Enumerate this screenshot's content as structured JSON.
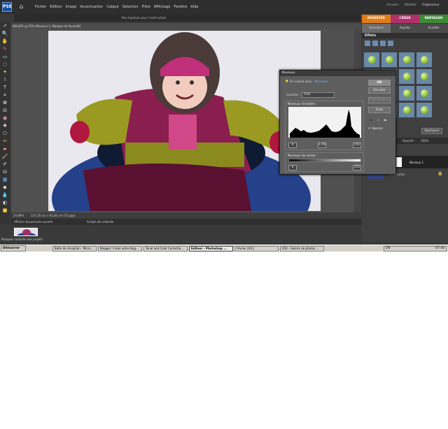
{
  "menubar": {
    "logo": "PSE",
    "items": [
      "Fichier",
      "Edition",
      "Image",
      "Accentuation",
      "Calque",
      "Sélection",
      "Filtre",
      "Affichage",
      "Fenêtre",
      "Aide"
    ],
    "undo": "Annuler",
    "redo": "Rétablir",
    "organizer": "Organiseur"
  },
  "options_bar": {
    "text": "Pas d'options pour l'outil activé."
  },
  "mode_tabs": [
    "MODIFIER",
    "CRÉER",
    "PARTAGER"
  ],
  "sub_tabs": [
    "Standard",
    "Rapide",
    "Guidée"
  ],
  "document": {
    "title": "066.JPG @ 25% (Niveaux 1, Masque de fusion/8)",
    "zoom": "24,96%",
    "size": "137,16 cm x 91,44 cm (72 ppp)"
  },
  "bin": {
    "open_docs": "Afficher documents ouverts",
    "scripts": "Scripts de corbeille",
    "label": "Masquer corbeille des projets"
  },
  "effects": {
    "title": "Effets",
    "apply": "Appliquer"
  },
  "layers": {
    "opacity_label": "Opacité :",
    "opacity_value": "100%",
    "layer1": "Niveaux 1",
    "layer2": "Arrière-plan"
  },
  "levels_dialog": {
    "title": "Niveaux",
    "learn_more": "En savoir plus :",
    "learn_link": "Niveaux",
    "ok": "OK",
    "cancel": "Annuler",
    "reset": "Réinitialiser",
    "auto": "Auto",
    "channel_label": "Couche :",
    "channel_value": "RVB",
    "input_label": "Niveaux d'entrée :",
    "input_black": "0",
    "input_gamma": "1,00",
    "input_white": "255",
    "output_label": "Niveaux de sortie :",
    "output_black": "0",
    "output_white": "255",
    "preview_label": "Aperçu"
  },
  "taskbar": {
    "start": "Démarrer",
    "tasks": [
      "Boîte de réception - Micro...",
      "Blogger: Créez votre blog...",
      "Tonal and Color Correctio...",
      "Editeur - Photoshop ...",
      "Février 2011",
      "050 - Galerie de photos ..."
    ],
    "lang": "EN",
    "clock": "07:44"
  }
}
